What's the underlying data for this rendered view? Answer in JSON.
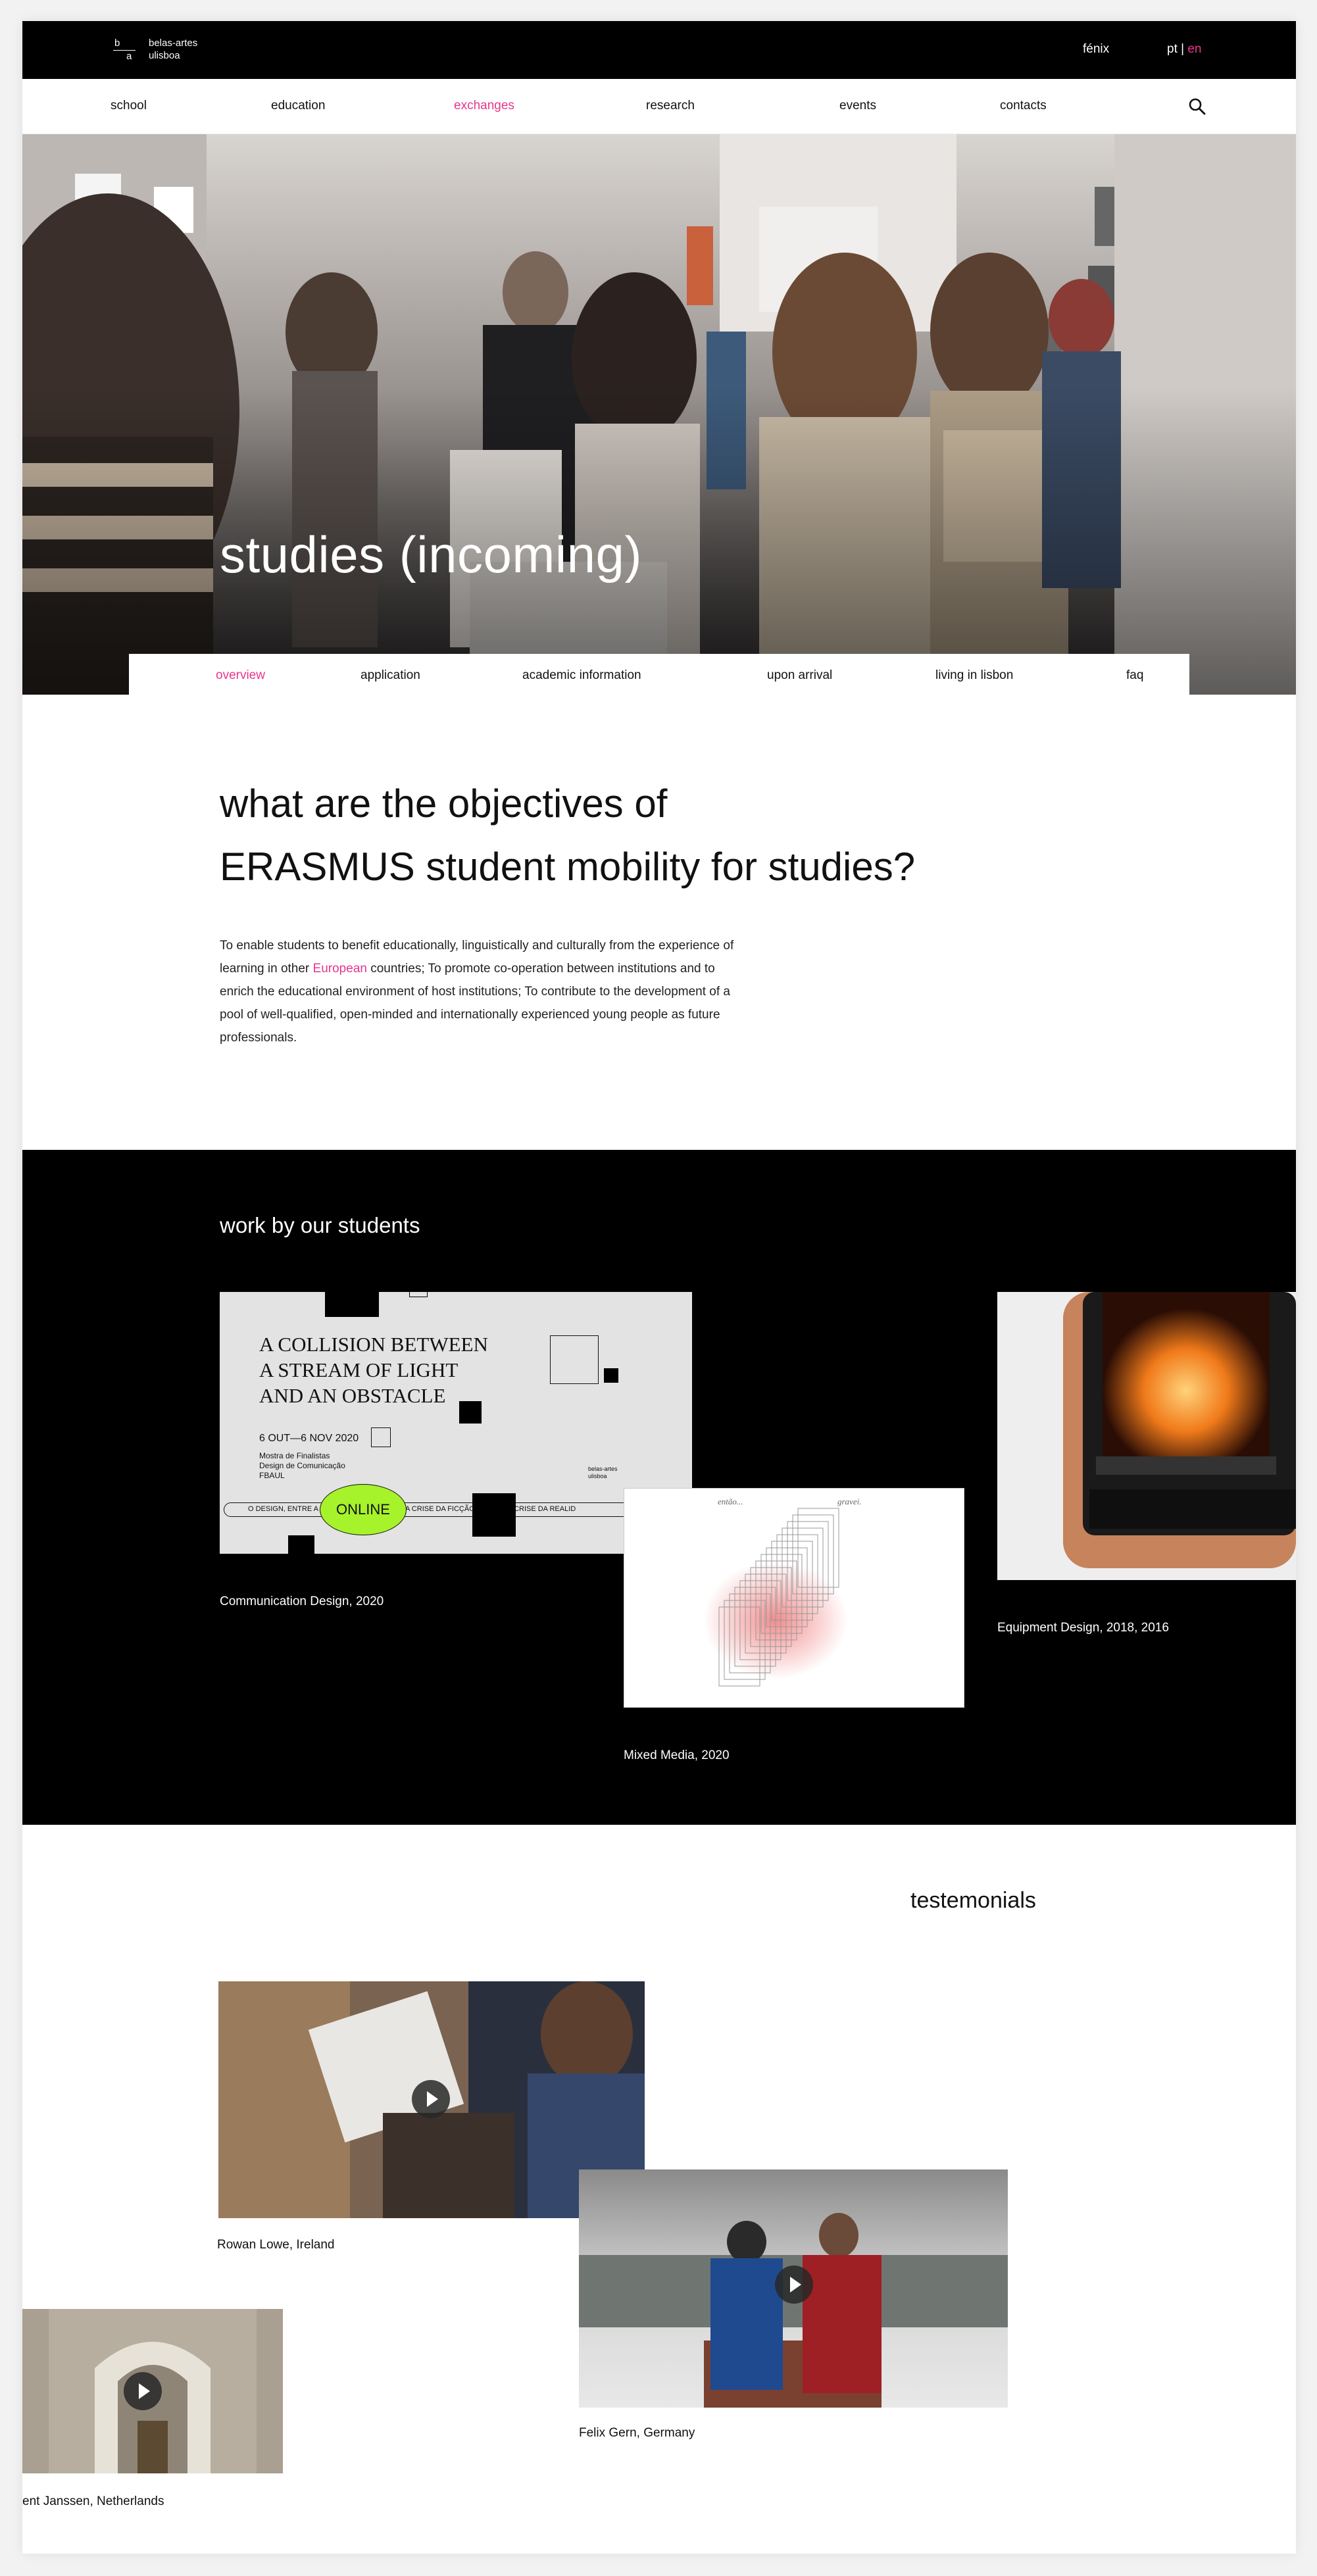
{
  "header": {
    "logo_letter_b": "b",
    "logo_letter_a": "a",
    "logo_line1": "belas-artes",
    "logo_line2": "ulisboa",
    "fenix": "fénix",
    "lang_pt": "pt",
    "lang_sep": "|",
    "lang_en": "en"
  },
  "nav": {
    "items": [
      "school",
      "education",
      "exchanges",
      "research",
      "events",
      "contacts"
    ],
    "active": "exchanges",
    "search_icon": "search-icon"
  },
  "hero": {
    "title": "studies (incoming)"
  },
  "subnav": {
    "items": [
      "overview",
      "application",
      "academic information",
      "upon arrival",
      "living in lisbon",
      "faq"
    ],
    "active": "overview"
  },
  "objectives": {
    "title_line1": "what are the objectives of",
    "title_line2": "ERASMUS student mobility for studies?",
    "body_before": "To enable students to benefit educationally, linguistically and culturally from the experience of learning in other ",
    "body_link": "European",
    "body_after": " countries; To promote co-operation between institutions and to enrich the educational environment of host institutions; To contribute to the development of a pool of well-qualified, open-minded and internationally experienced young people as future professionals."
  },
  "work": {
    "title": "work by our students",
    "items": [
      {
        "caption": "Communication Design, 2020"
      },
      {
        "caption": "Mixed Media, 2020"
      },
      {
        "caption": "Equipment Design, 2018, 2016"
      }
    ],
    "poster": {
      "line1": "A COLLISION BETWEEN",
      "line2": "A STREAM OF LIGHT",
      "line3": "AND AN OBSTACLE",
      "dates": "6 OUT—6 NOV 2020",
      "info1": "Mostra de Finalistas",
      "info2": "Design de Comunicação",
      "info3": "FBAUL",
      "badge": "ONLINE",
      "ticker": "O DESIGN, ENTRE A CRISE DA REALIDADE E A CRISE DA FICÇÃO · ENTRE A CRISE DA REALID",
      "mini_logo1": "belas-artes",
      "mini_logo2": "ulisboa"
    },
    "sketch": {
      "left_word": "então...",
      "right_word": "gravei."
    }
  },
  "testimonials": {
    "title": "testemonials",
    "items": [
      {
        "caption": "Rowan Lowe, Ireland"
      },
      {
        "caption": "Felix Gern, Germany"
      },
      {
        "caption": "ent Janssen, Netherlands"
      }
    ]
  },
  "colors": {
    "accent": "#e8368f",
    "black": "#000000",
    "lime": "#a6f22b"
  }
}
